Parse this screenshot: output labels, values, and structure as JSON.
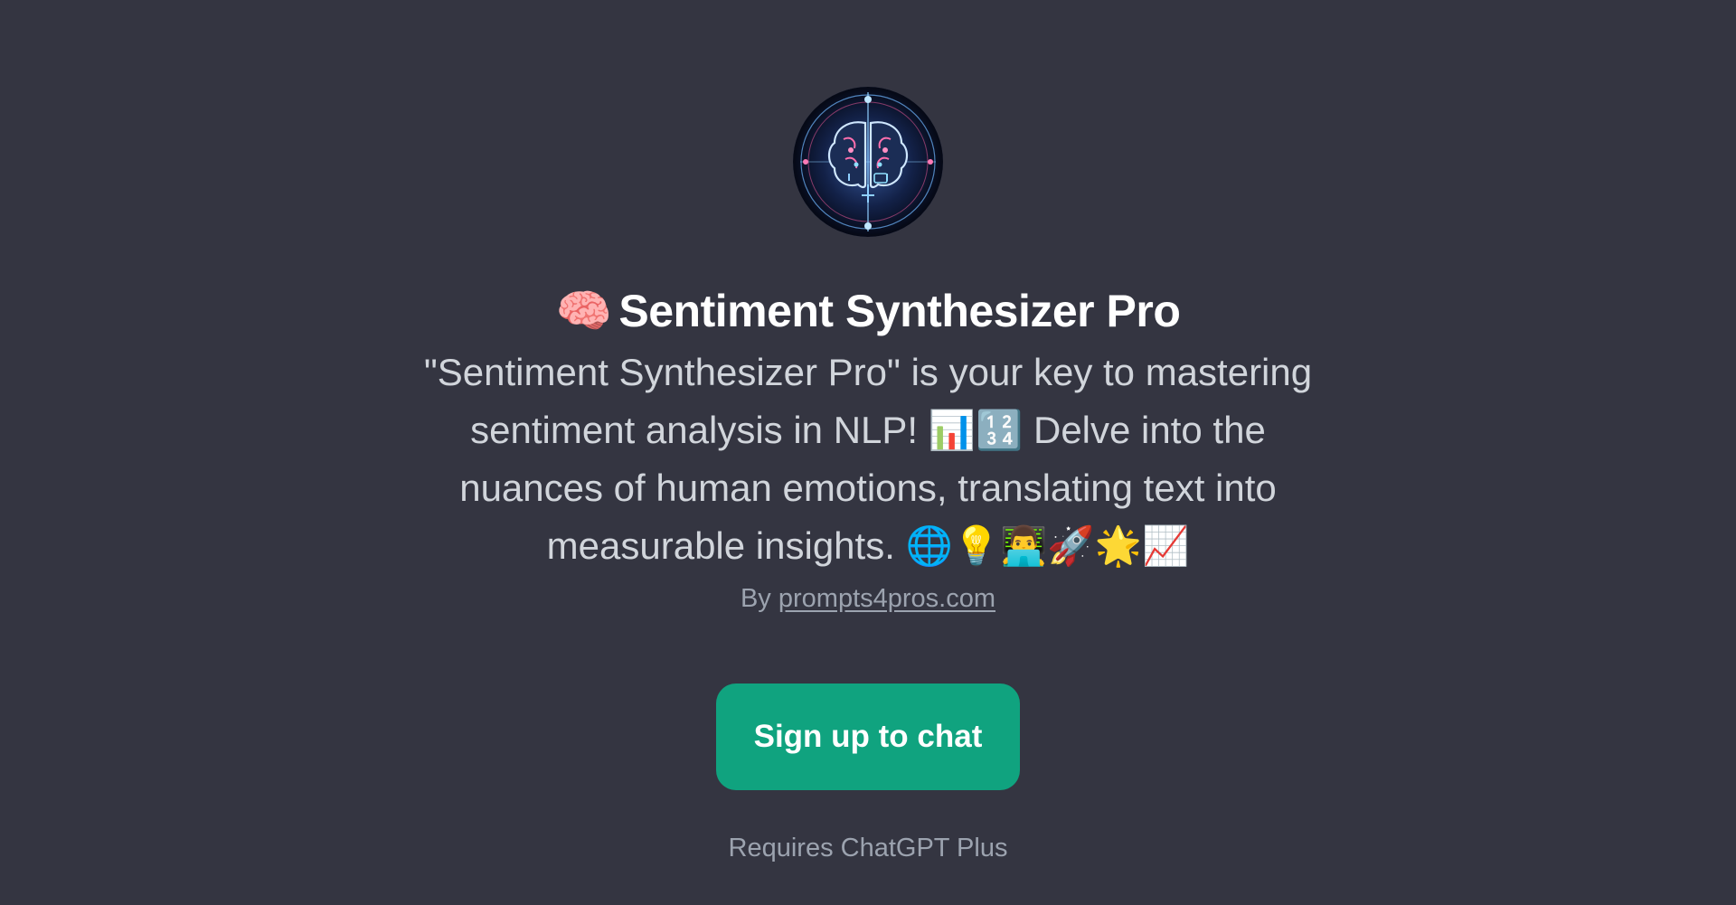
{
  "gpt": {
    "avatar_icon": "brain-circuit-avatar",
    "title_emoji": "🧠",
    "title": "Sentiment Synthesizer Pro",
    "description": "\"Sentiment Synthesizer Pro\" is your key to mastering sentiment analysis in NLP! 📊🔢 Delve into the nuances of human emotions, translating text into measurable insights. 🌐💡👨‍💻🚀🌟📈",
    "author_prefix": "By",
    "author_link": "prompts4pros.com"
  },
  "cta": {
    "signup_label": "Sign up to chat",
    "requirement": "Requires ChatGPT Plus"
  },
  "colors": {
    "background": "#343541",
    "accent": "#10a37f",
    "title": "#ffffff",
    "description": "#d1d5db",
    "muted": "#9ca3af"
  }
}
